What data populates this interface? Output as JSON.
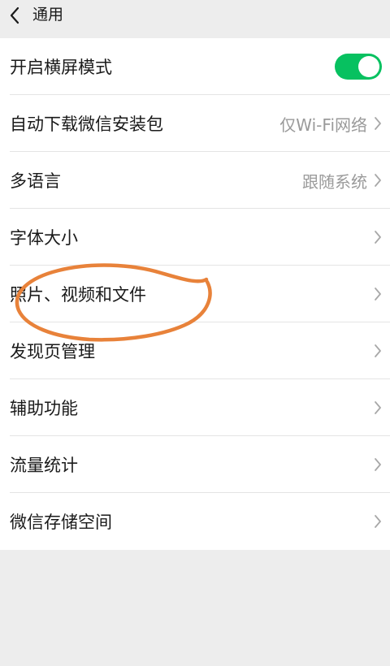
{
  "header": {
    "title": "通用",
    "back_icon": "chevron-left-icon"
  },
  "settings": {
    "items": [
      {
        "label": "开启横屏模式",
        "value": "",
        "control": "toggle",
        "toggle_on": true
      },
      {
        "label": "自动下载微信安装包",
        "value": "仅Wi-Fi网络",
        "control": "chevron"
      },
      {
        "label": "多语言",
        "value": "跟随系统",
        "control": "chevron"
      },
      {
        "label": "字体大小",
        "value": "",
        "control": "chevron"
      },
      {
        "label": "照片、视频和文件",
        "value": "",
        "control": "chevron"
      },
      {
        "label": "发现页管理",
        "value": "",
        "control": "chevron"
      },
      {
        "label": "辅助功能",
        "value": "",
        "control": "chevron"
      },
      {
        "label": "流量统计",
        "value": "",
        "control": "chevron"
      },
      {
        "label": "微信存储空间",
        "value": "",
        "control": "chevron"
      }
    ]
  },
  "colors": {
    "toggle_on": "#07c160",
    "annotation_stroke": "#e8823a",
    "background": "#ededed"
  },
  "annotation": {
    "shape": "hand-drawn-ellipse",
    "highlights": "照片、视频和文件"
  }
}
